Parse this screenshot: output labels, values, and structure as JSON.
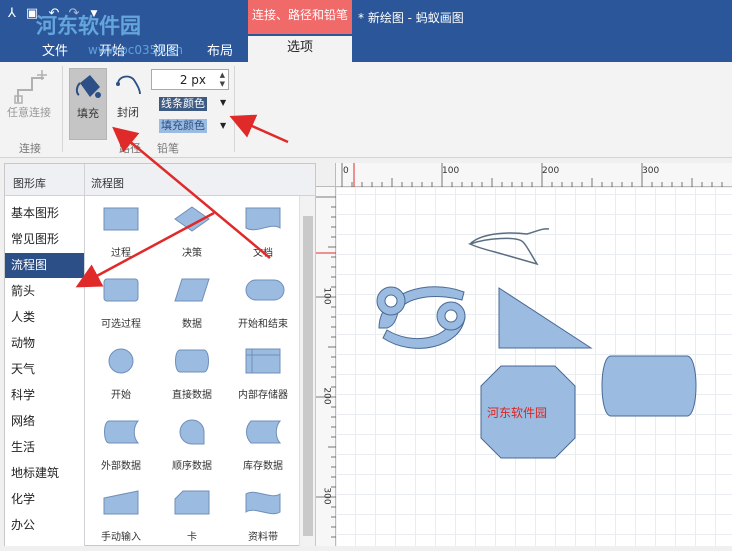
{
  "window": {
    "title": "* 新绘图 - 蚂蚁画图",
    "context_tab": "连接、路径和铅笔",
    "watermark": "河东软件园",
    "watermark_url": "www.pc0359.cn"
  },
  "menu": {
    "tabs": [
      "文件",
      "开始",
      "视图",
      "布局"
    ],
    "active_tab": "选项"
  },
  "ribbon": {
    "connect_group": {
      "label": "连接",
      "any_connect": "任意连接"
    },
    "path_group": {
      "label": "路径",
      "fill": "填充",
      "close": "封闭"
    },
    "pencil_group": {
      "label": "铅笔",
      "line_width": "2 px",
      "line_color": "线条颜色",
      "fill_color": "填充颜色"
    }
  },
  "shapes_panel": {
    "header_library": "图形库",
    "header_category": "流程图",
    "categories": [
      "基本图形",
      "常见图形",
      "流程图",
      "箭头",
      "人类",
      "动物",
      "天气",
      "科学",
      "网络",
      "生活",
      "地标建筑",
      "化学",
      "办公"
    ],
    "selected_category": "流程图",
    "shapes": [
      "过程",
      "决策",
      "文档",
      "可选过程",
      "数据",
      "开始和结束",
      "开始",
      "直接数据",
      "内部存储器",
      "外部数据",
      "顺序数据",
      "库存数据",
      "手动输入",
      "卡",
      "资料带"
    ]
  },
  "ruler": {
    "top": [
      "0",
      "100",
      "200",
      "300"
    ],
    "left": [
      "100",
      "200",
      "300"
    ]
  },
  "canvas": {
    "octagon_label": "河东软件园"
  },
  "colors": {
    "accent": "#2b579a",
    "context": "#f06a6a",
    "shape_fill": "#9bbbe0",
    "shape_stroke": "#4a6a96",
    "arrow": "#e02a2a"
  }
}
